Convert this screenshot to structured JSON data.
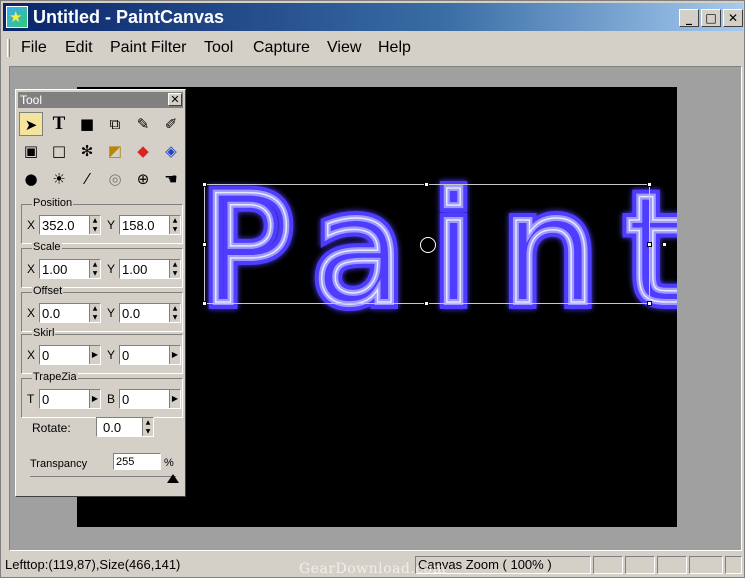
{
  "window": {
    "title": "Untitled - PaintCanvas",
    "controls": {
      "minimize": "_",
      "maximize": "□",
      "close": "✕"
    }
  },
  "menu": {
    "items": [
      "File",
      "Edit",
      "Paint Filter",
      "Tool",
      "Capture",
      "View",
      "Help"
    ]
  },
  "canvas": {
    "background": "#000000",
    "text_object": "Paint",
    "text_color": "#8c87f5",
    "glow_color": "#4f3cff"
  },
  "tool_panel": {
    "title": "Tool",
    "close": "✕",
    "tools": [
      {
        "name": "pointer-icon",
        "glyph": "➤"
      },
      {
        "name": "text-tool-icon",
        "glyph": "T"
      },
      {
        "name": "rectangle-fill-icon",
        "glyph": "■"
      },
      {
        "name": "transform-icon",
        "glyph": "⧉"
      },
      {
        "name": "pen-add-icon",
        "glyph": "✎"
      },
      {
        "name": "pen-icon",
        "glyph": "✐"
      },
      {
        "name": "select-region-icon",
        "glyph": "▣"
      },
      {
        "name": "rectangle-outline-icon",
        "glyph": "□"
      },
      {
        "name": "magic-wand-icon",
        "glyph": "✻"
      },
      {
        "name": "eraser-icon",
        "glyph": "◩"
      },
      {
        "name": "paint-bucket-icon",
        "glyph": "◆"
      },
      {
        "name": "color-bucket-icon",
        "glyph": "◈"
      },
      {
        "name": "drop-icon",
        "glyph": "●"
      },
      {
        "name": "brightness-icon",
        "glyph": "☀"
      },
      {
        "name": "eyedropper-icon",
        "glyph": "⁄"
      },
      {
        "name": "smudge-icon",
        "glyph": "◎"
      },
      {
        "name": "zoom-icon",
        "glyph": "⊕"
      },
      {
        "name": "hand-icon",
        "glyph": "☚"
      }
    ],
    "position": {
      "label": "Position",
      "x_label": "X",
      "x": "352.0",
      "y_label": "Y",
      "y": "158.0"
    },
    "scale": {
      "label": "Scale",
      "x_label": "X",
      "x": "1.00",
      "y_label": "Y",
      "y": "1.00"
    },
    "offset": {
      "label": "Offset",
      "x_label": "X",
      "x": "0.0",
      "y_label": "Y",
      "y": "0.0"
    },
    "skirl": {
      "label": "Skirl",
      "x_label": "X",
      "x": "0",
      "y_label": "Y",
      "y": "0"
    },
    "trapezia": {
      "label": "TrapeZia",
      "t_label": "T",
      "t": "0",
      "b_label": "B",
      "b": "0"
    },
    "rotate": {
      "label": "Rotate:",
      "value": "0.0"
    },
    "transparency": {
      "label": "Transpancy",
      "value": "255",
      "unit": "%",
      "level": 1.0
    }
  },
  "status": {
    "left": "Lefttop:(119,87),Size(466,141)",
    "zoom": "Canvas Zoom ( 100% )",
    "watermark": "GearDownload.com"
  }
}
